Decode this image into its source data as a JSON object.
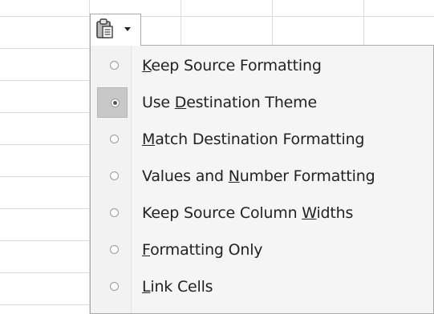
{
  "paste_options": {
    "selected_index": 1,
    "items": [
      {
        "pre": "",
        "key": "K",
        "post": "eep Source Formatting"
      },
      {
        "pre": "Use ",
        "key": "D",
        "post": "estination Theme"
      },
      {
        "pre": "",
        "key": "M",
        "post": "atch Destination Formatting"
      },
      {
        "pre": "Values and ",
        "key": "N",
        "post": "umber Formatting"
      },
      {
        "pre": "Keep Source Column ",
        "key": "W",
        "post": "idths"
      },
      {
        "pre": "",
        "key": "F",
        "post": "ormatting Only"
      },
      {
        "pre": "",
        "key": "L",
        "post": "ink Cells"
      }
    ]
  },
  "icons": {
    "paste": "clipboard-icon",
    "dropdown": "dropdown-caret-icon",
    "option": "radio-icon"
  }
}
